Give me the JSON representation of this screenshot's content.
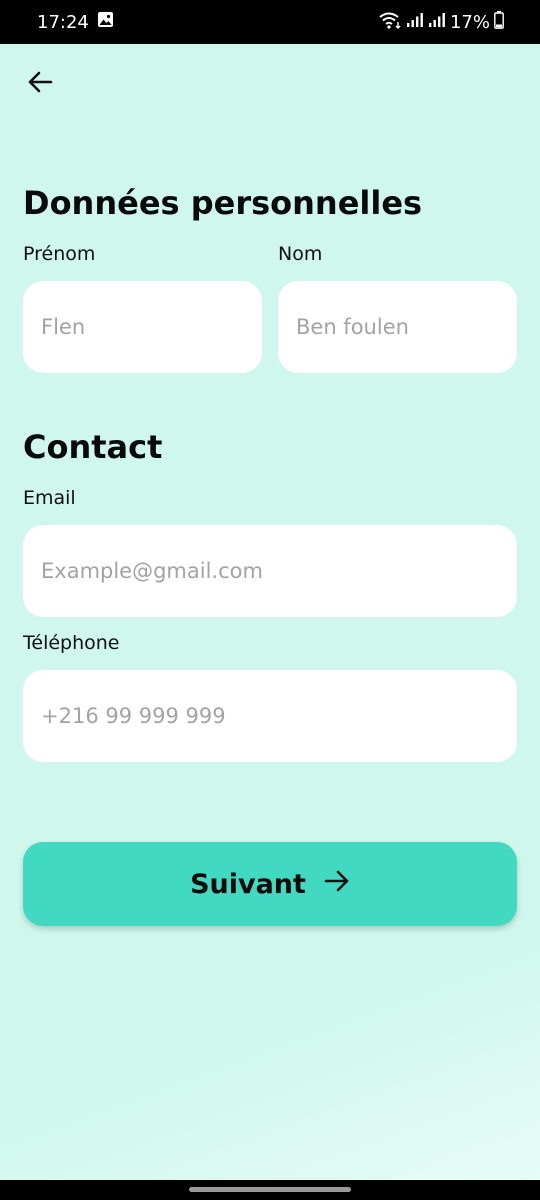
{
  "status_bar": {
    "time": "17:24",
    "battery": "17%",
    "icons": [
      "image-notification-icon",
      "wifi-icon",
      "signal-icon",
      "signal-icon",
      "battery-icon"
    ]
  },
  "header": {
    "back_icon": "arrow-left-icon"
  },
  "personal": {
    "title": "Données personnelles",
    "first_name_label": "Prénom",
    "first_name_placeholder": "Flen",
    "first_name_value": "",
    "last_name_label": "Nom",
    "last_name_placeholder": "Ben foulen",
    "last_name_value": ""
  },
  "contact": {
    "title": "Contact",
    "email_label": "Email",
    "email_placeholder": "Example@gmail.com",
    "email_value": "",
    "phone_label": "Téléphone",
    "phone_placeholder": "+216 99 999 999",
    "phone_value": ""
  },
  "actions": {
    "next_label": "Suivant",
    "next_icon": "arrow-right-icon"
  },
  "colors": {
    "background": "#cff7ec",
    "accent": "#42d9c3",
    "input_bg": "#ffffff",
    "placeholder": "#a3a3a3"
  }
}
